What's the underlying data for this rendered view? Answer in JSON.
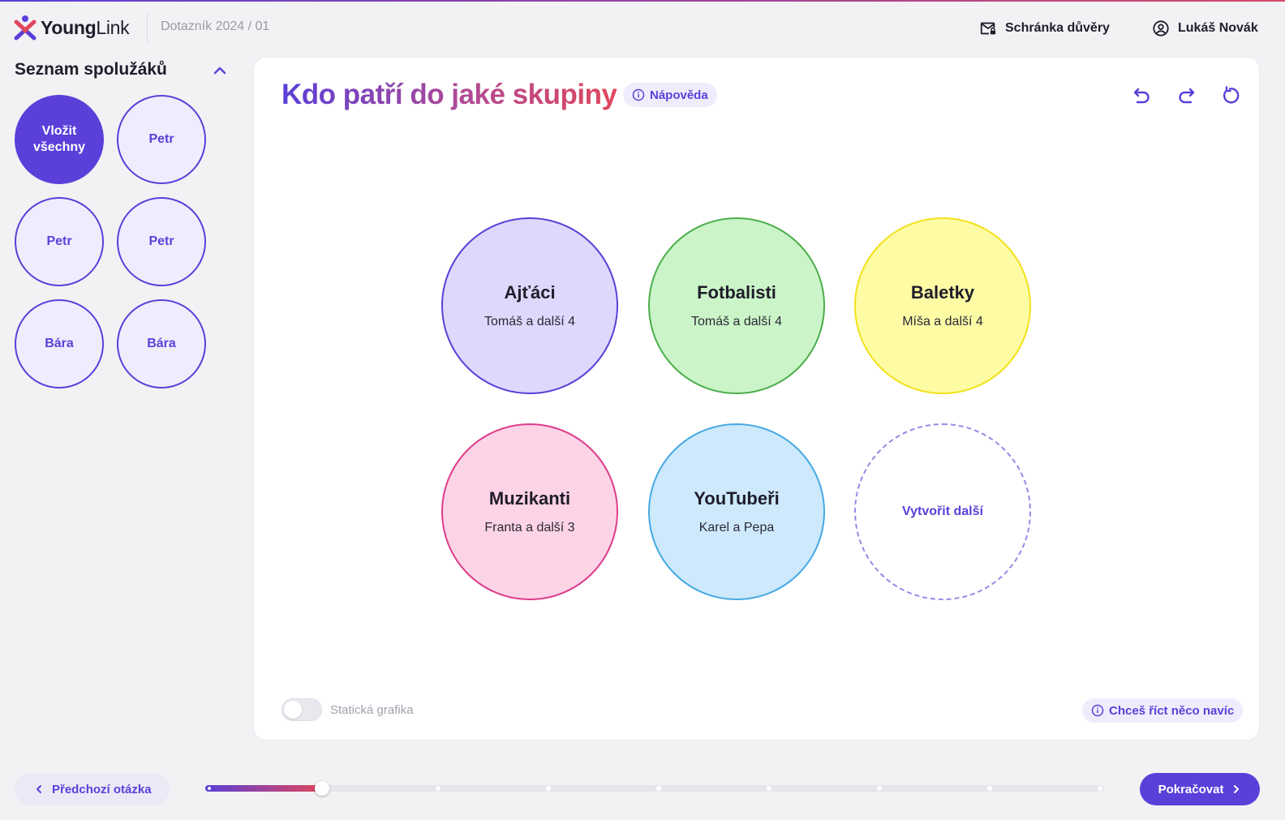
{
  "header": {
    "logo_bold": "Young",
    "logo_light": "Link",
    "survey_crumb": "Dotazník 2024 / 01",
    "inbox_label": "Schránka důvěry",
    "user_name": "Lukáš Novák"
  },
  "sidebar": {
    "title": "Seznam spolužáků",
    "insert_all_line1": "Vložit",
    "insert_all_line2": "všechny",
    "classmates": [
      "Petr",
      "Petr",
      "Petr",
      "Bára",
      "Bára"
    ]
  },
  "main": {
    "title": "Kdo patří do jaké skupiny",
    "help_label": "Nápověda",
    "groups": [
      {
        "name": "Ajťáci",
        "members": "Tomáš a další 4",
        "fill": "#ddd9fc",
        "border": "#5b3fd9"
      },
      {
        "name": "Fotbalisti",
        "members": "Tomáš a další 4",
        "fill": "#cbf5c8",
        "border": "#4cae4c"
      },
      {
        "name": "Baletky",
        "members": "Míša a další 4",
        "fill": "#fdfca4",
        "border": "#f2e11a"
      },
      {
        "name": "Muzikanti",
        "members": "Franta a další 3",
        "fill": "#fdd3e6",
        "border": "#dd3c8a"
      },
      {
        "name": "YouTubeři",
        "members": "Karel a Pepa",
        "fill": "#cde9fb",
        "border": "#46a9e3"
      }
    ],
    "create_label": "Vytvořit další",
    "toggle_label": "Statická grafika",
    "toggle_on": false,
    "say_more_label": "Chceš říct něco navíc"
  },
  "footer": {
    "prev_label": "Předchozí otázka",
    "next_label": "Pokračovat",
    "progress_fraction": 0.13,
    "progress_steps": 9
  },
  "colors": {
    "accent": "#5b3fd9",
    "gradient_end": "#e0475d"
  },
  "icons": {
    "undo": "undo-icon",
    "redo": "redo-icon",
    "reset": "reset-icon",
    "inbox": "mail-lock-icon",
    "user": "user-circle-icon",
    "info": "info-icon"
  }
}
